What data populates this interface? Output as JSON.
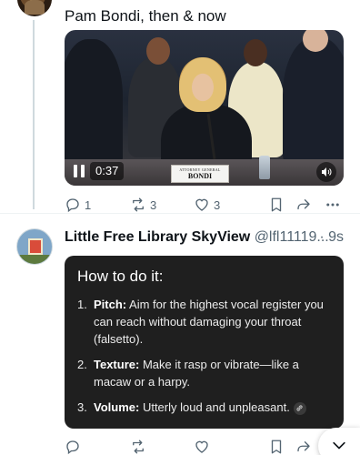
{
  "post1": {
    "text": "Pam Bondi, then & now",
    "video": {
      "time": "0:37",
      "nameplate_title": "ATTORNEY GENERAL",
      "nameplate_name": "BONDI"
    },
    "actions": {
      "replies": "1",
      "reposts": "3",
      "likes": "3"
    }
  },
  "post2": {
    "name": "Little Free Library SkyView",
    "handle": "@lfl11119...",
    "time": "· 9s",
    "card": {
      "title": "How to do it:",
      "items": [
        {
          "num": "1.",
          "label": "Pitch:",
          "text": " Aim for the highest vocal register you can reach without damaging your throat (falsetto)."
        },
        {
          "num": "2.",
          "label": "Texture:",
          "text": " Make it rasp or vibrate—like a macaw or a harpy."
        },
        {
          "num": "3.",
          "label": "Volume:",
          "text": " Utterly loud and unpleasant."
        }
      ]
    }
  },
  "colors": {
    "icon": "#536471",
    "card_bg": "#1f1f1f",
    "text": "#0f1419"
  }
}
